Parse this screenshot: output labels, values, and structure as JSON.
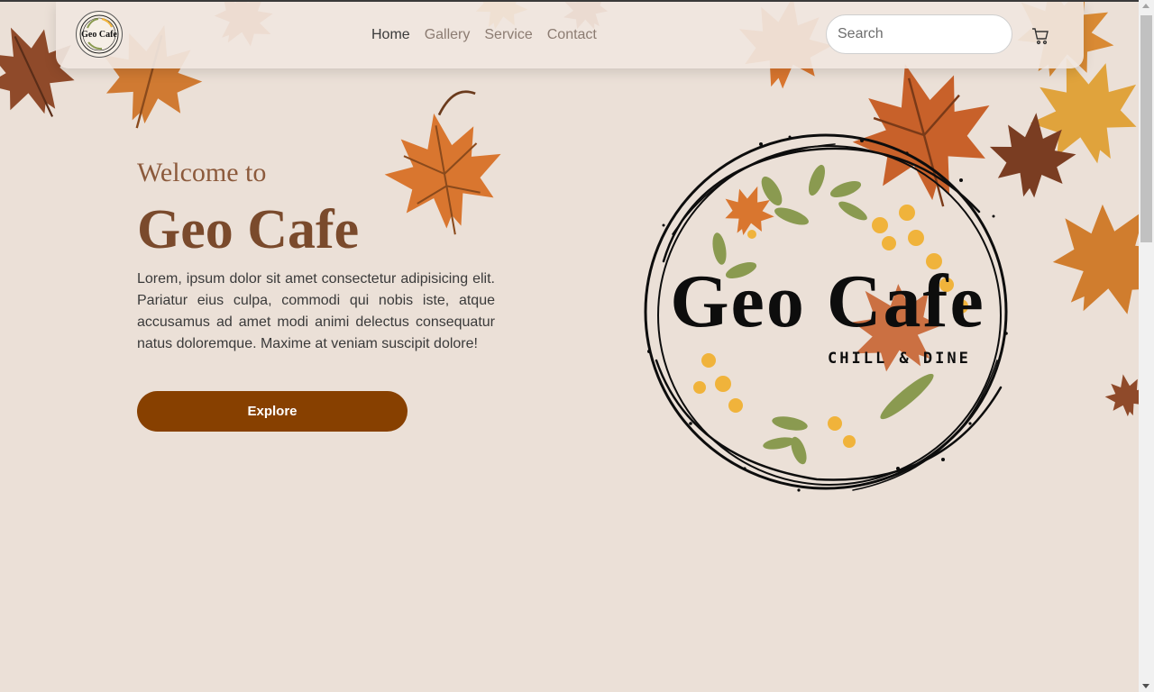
{
  "navbar": {
    "logo_text": "Geo Cafe",
    "links": [
      {
        "label": "Home",
        "active": true
      },
      {
        "label": "Gallery",
        "active": false
      },
      {
        "label": "Service",
        "active": false
      },
      {
        "label": "Contact",
        "active": false
      }
    ],
    "search_placeholder": "Search",
    "cart_icon": "cart-icon"
  },
  "hero": {
    "welcome": "Welcome to",
    "title": "Geo Cafe",
    "description": "Lorem, ipsum dolor sit amet consectetur adipisicing elit. Pariatur eius culpa, commodi qui nobis iste, atque accusamus ad amet modi animi delectus consequatur natus doloremque. Maxime at veniam suscipit dolore!",
    "button_label": "Explore"
  },
  "logo": {
    "title": "Geo Cafe",
    "tagline": "CHILL & DINE"
  },
  "colors": {
    "background": "#ebe0d7",
    "button": "#874000",
    "welcome_text": "#8c5a3c",
    "title_text": "#7a4a2c",
    "leaf_orange": "#d9762f",
    "leaf_brown": "#8f4a2a",
    "leaf_green": "#8a9a50",
    "flower_yellow": "#f0b33b"
  },
  "icons": [
    "cart-icon",
    "maple-leaf-icon",
    "scroll-up-arrow-icon",
    "scroll-down-arrow-icon"
  ]
}
